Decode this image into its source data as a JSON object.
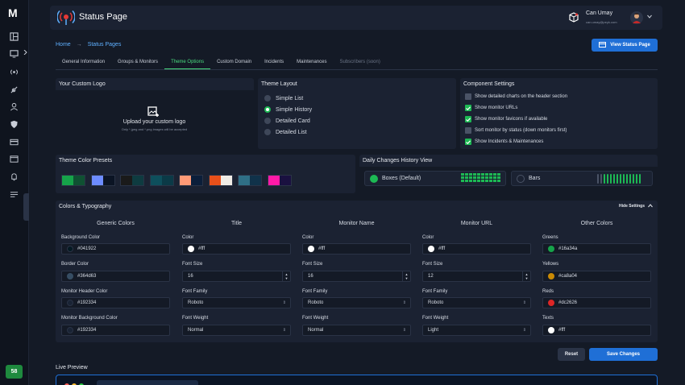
{
  "app": {
    "logo_letter": "M",
    "title": "Status Page",
    "badge": "58"
  },
  "user": {
    "name": "Can Umay",
    "email": "can.umay@peyk.com"
  },
  "breadcrumb": {
    "home": "Home",
    "current": "Status Pages"
  },
  "actions": {
    "view_status_page": "View Status Page",
    "reset": "Reset",
    "save": "Save Changes",
    "hide_settings": "Hide Settings"
  },
  "tabs": [
    {
      "label": "General Information",
      "state": "normal"
    },
    {
      "label": "Groups & Monitors",
      "state": "normal"
    },
    {
      "label": "Theme Options",
      "state": "active"
    },
    {
      "label": "Custom Domain",
      "state": "normal"
    },
    {
      "label": "Incidents",
      "state": "normal"
    },
    {
      "label": "Maintenances",
      "state": "normal"
    },
    {
      "label": "Subscribers (soon)",
      "state": "disabled"
    }
  ],
  "logo_card": {
    "title": "Your Custom Logo",
    "upload_text": "Upload your custom logo",
    "hint": "Only *.jpeg and *.png images will be accepted"
  },
  "layout_card": {
    "title": "Theme Layout",
    "options": [
      {
        "label": "Simple List",
        "selected": false
      },
      {
        "label": "Simple History",
        "selected": true
      },
      {
        "label": "Detailed Card",
        "selected": false
      },
      {
        "label": "Detailed List",
        "selected": false
      }
    ]
  },
  "component_card": {
    "title": "Component Settings",
    "options": [
      {
        "label": "Show detailed charts on the header section",
        "checked": false
      },
      {
        "label": "Show monitor URLs",
        "checked": true
      },
      {
        "label": "Show monitor favicons if available",
        "checked": true
      },
      {
        "label": "Sort monitor by status (down monitors first)",
        "checked": false
      },
      {
        "label": "Show Incidents & Maintenances",
        "checked": true
      }
    ]
  },
  "presets_card": {
    "title": "Theme Color Presets",
    "presets": [
      [
        "#16a34a",
        "#0f5132"
      ],
      [
        "#6d8cff",
        "#0b1424"
      ],
      [
        "#1a1a1a",
        "#0e3b40"
      ],
      [
        "#0e4f5c",
        "#0b3a47"
      ],
      [
        "#ff9a76",
        "#0b1e3a"
      ],
      [
        "#e8501a",
        "#f0ece6"
      ],
      [
        "#2f6f86",
        "#10324a"
      ],
      [
        "#ff1aa8",
        "#1a1040"
      ]
    ]
  },
  "history_card": {
    "title": "Daily Changes History View",
    "options": [
      {
        "label": "Boxes (Default)",
        "selected": true
      },
      {
        "label": "Bars",
        "selected": false
      }
    ]
  },
  "colors_card": {
    "title": "Colors & Typography",
    "generic": {
      "heading": "Generic Colors",
      "fields": [
        {
          "label": "Background Color",
          "value": "#041922"
        },
        {
          "label": "Border Color",
          "value": "#364d63"
        },
        {
          "label": "Monitor Header Color",
          "value": "#192334"
        },
        {
          "label": "Monitor Background Color",
          "value": "#192334"
        }
      ]
    },
    "title_col": {
      "heading": "Title",
      "color": "#fff",
      "font_size": "16",
      "font_family": "Roboto",
      "font_weight": "Normal"
    },
    "monitor_name": {
      "heading": "Monitor Name",
      "color": "#fff",
      "font_size": "16",
      "font_family": "Roboto",
      "font_weight": "Normal"
    },
    "monitor_url": {
      "heading": "Monitor URL",
      "color": "#fff",
      "font_size": "12",
      "font_family": "Roboto",
      "font_weight": "Light"
    },
    "labels": {
      "color": "Color",
      "font_size": "Font Size",
      "font_family": "Font Family",
      "font_weight": "Font Weight"
    },
    "other": {
      "heading": "Other Colors",
      "fields": [
        {
          "label": "Greens",
          "value": "#16a34a"
        },
        {
          "label": "Yellows",
          "value": "#ca8a04"
        },
        {
          "label": "Reds",
          "value": "#dc2626"
        },
        {
          "label": "Texts",
          "value": "#fff"
        }
      ]
    }
  },
  "live_preview": {
    "title": "Live Preview"
  },
  "colors": {
    "accent": "#1db954",
    "primary": "#1f6fd6",
    "link": "#5fb0ff",
    "tab_active": "#4ade80"
  }
}
